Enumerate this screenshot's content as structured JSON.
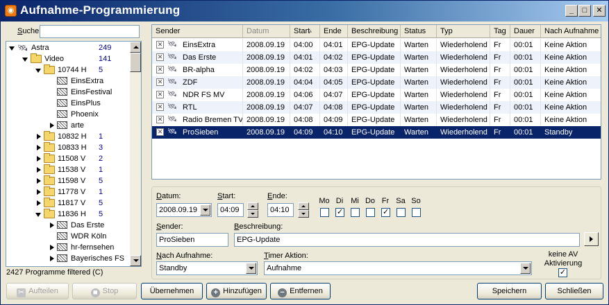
{
  "window": {
    "title": "Aufnahme-Programmierung",
    "icon": "rss-icon",
    "controls": {
      "minimize": "_",
      "maximize": "□",
      "close": "✕"
    }
  },
  "search": {
    "label_u": "S",
    "label_rest": "uche",
    "value": ""
  },
  "tree": {
    "items": [
      {
        "label": "Astra",
        "count": "249",
        "icon": "satellite-icon",
        "level": 0,
        "state": "open"
      },
      {
        "label": "Video",
        "count": "141",
        "icon": "folder-icon",
        "level": 1,
        "state": "open"
      },
      {
        "label": "10744 H",
        "count": "5",
        "icon": "folder-icon",
        "level": 2,
        "state": "open"
      },
      {
        "label": "EinsExtra",
        "count": "",
        "icon": "tv-icon",
        "level": 3,
        "state": "none"
      },
      {
        "label": "EinsFestival",
        "count": "",
        "icon": "tv-icon",
        "level": 3,
        "state": "none"
      },
      {
        "label": "EinsPlus",
        "count": "",
        "icon": "tv-icon",
        "level": 3,
        "state": "none"
      },
      {
        "label": "Phoenix",
        "count": "",
        "icon": "tv-icon",
        "level": 3,
        "state": "none"
      },
      {
        "label": "arte",
        "count": "",
        "icon": "tv-icon",
        "level": 3,
        "state": "closed"
      },
      {
        "label": "10832 H",
        "count": "1",
        "icon": "folder-icon",
        "level": 2,
        "state": "closed"
      },
      {
        "label": "10833 H",
        "count": "3",
        "icon": "folder-icon",
        "level": 2,
        "state": "closed"
      },
      {
        "label": "11508 V",
        "count": "2",
        "icon": "folder-icon",
        "level": 2,
        "state": "closed"
      },
      {
        "label": "11538 V",
        "count": "1",
        "icon": "folder-icon",
        "level": 2,
        "state": "closed"
      },
      {
        "label": "11598 V",
        "count": "5",
        "icon": "folder-icon",
        "level": 2,
        "state": "closed"
      },
      {
        "label": "11778 V",
        "count": "1",
        "icon": "folder-icon",
        "level": 2,
        "state": "closed"
      },
      {
        "label": "11817 V",
        "count": "5",
        "icon": "folder-icon",
        "level": 2,
        "state": "closed"
      },
      {
        "label": "11836 H",
        "count": "5",
        "icon": "folder-icon",
        "level": 2,
        "state": "open"
      },
      {
        "label": "Das Erste",
        "count": "",
        "icon": "tv-icon",
        "level": 3,
        "state": "closed"
      },
      {
        "label": "WDR Köln",
        "count": "",
        "icon": "tv-icon",
        "level": 3,
        "state": "none"
      },
      {
        "label": "hr-fernsehen",
        "count": "",
        "icon": "tv-icon",
        "level": 3,
        "state": "closed"
      },
      {
        "label": "Bayerisches FS",
        "count": "",
        "icon": "tv-icon",
        "level": 3,
        "state": "closed"
      }
    ],
    "status": "2427 Programme  filtered (C)"
  },
  "table": {
    "columns": [
      "Sender",
      "Datum",
      "Start",
      "Ende",
      "Beschreibung",
      "Status",
      "Typ",
      "Tag",
      "Dauer",
      "Nach Aufnahme"
    ],
    "sorted_column": "Datum",
    "rows": [
      [
        "EinsExtra",
        "2008.09.19",
        "04:00",
        "04:01",
        "EPG-Update",
        "Warten",
        "Wiederholend",
        "Fr",
        "00:01",
        "Keine Aktion"
      ],
      [
        "Das Erste",
        "2008.09.19",
        "04:01",
        "04:02",
        "EPG-Update",
        "Warten",
        "Wiederholend",
        "Fr",
        "00:01",
        "Keine Aktion"
      ],
      [
        "BR-alpha",
        "2008.09.19",
        "04:02",
        "04:03",
        "EPG-Update",
        "Warten",
        "Wiederholend",
        "Fr",
        "00:01",
        "Keine Aktion"
      ],
      [
        "ZDF",
        "2008.09.19",
        "04:04",
        "04:05",
        "EPG-Update",
        "Warten",
        "Wiederholend",
        "Fr",
        "00:01",
        "Keine Aktion"
      ],
      [
        "NDR FS MV",
        "2008.09.19",
        "04:06",
        "04:07",
        "EPG-Update",
        "Warten",
        "Wiederholend",
        "Fr",
        "00:01",
        "Keine Aktion"
      ],
      [
        "RTL",
        "2008.09.19",
        "04:07",
        "04:08",
        "EPG-Update",
        "Warten",
        "Wiederholend",
        "Fr",
        "00:01",
        "Keine Aktion"
      ],
      [
        "Radio Bremen TV",
        "2008.09.19",
        "04:08",
        "04:09",
        "EPG-Update",
        "Warten",
        "Wiederholend",
        "Fr",
        "00:01",
        "Keine Aktion"
      ],
      [
        "ProSieben",
        "2008.09.19",
        "04:09",
        "04:10",
        "EPG-Update",
        "Warten",
        "Wiederholend",
        "Fr",
        "00:01",
        "Standby"
      ]
    ],
    "selected_row": 7
  },
  "form": {
    "datum_label": "Datum:",
    "datum_value": "2008.09.19",
    "start_label": "Start:",
    "start_value": "04:09",
    "ende_label": "Ende:",
    "ende_value": "04:10",
    "days": [
      {
        "label": "Mo",
        "checked": false
      },
      {
        "label": "Di",
        "checked": true
      },
      {
        "label": "Mi",
        "checked": false
      },
      {
        "label": "Do",
        "checked": false
      },
      {
        "label": "Fr",
        "checked": true
      },
      {
        "label": "Sa",
        "checked": false
      },
      {
        "label": "So",
        "checked": false
      }
    ],
    "sender_label": "Sender:",
    "sender_value": "ProSieben",
    "beschreibung_label": "Beschreibung:",
    "beschreibung_value": "EPG-Update",
    "nach_label": "Nach Aufnahme:",
    "nach_value": "Standby",
    "timer_label": "Timer Aktion:",
    "timer_value": "Aufnahme",
    "keine_av_line1": "keine AV",
    "keine_av_line2": "Aktivierung",
    "keine_av_checked": true
  },
  "buttons": {
    "aufteilen": "Aufteilen",
    "stop": "Stop",
    "uebernehmen": "Übernehmen",
    "hinzufuegen": "Hinzufügen",
    "entfernen": "Entfernen",
    "speichern": "Speichern",
    "schliessen": "Schließen"
  }
}
